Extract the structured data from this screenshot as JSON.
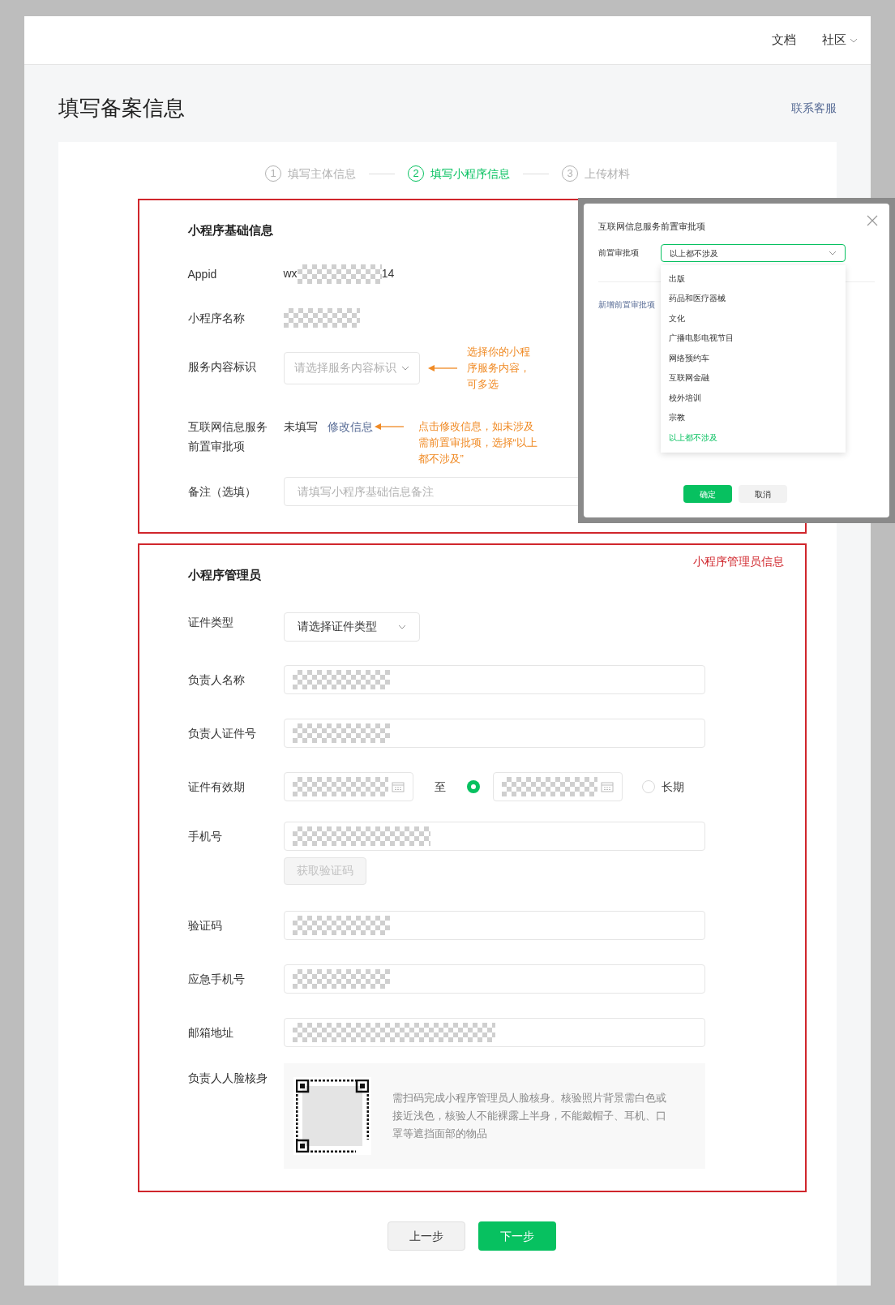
{
  "header": {
    "links": [
      {
        "label": "文档",
        "dropdown": false
      },
      {
        "label": "社区",
        "dropdown": true
      }
    ]
  },
  "page_title": "填写备案信息",
  "support_link": "联系客服",
  "steps": [
    {
      "number": "1",
      "label": "填写主体信息",
      "selected": false
    },
    {
      "number": "2",
      "label": "填写小程序信息",
      "selected": true
    },
    {
      "number": "3",
      "label": "上传材料",
      "selected": false
    }
  ],
  "basic_info": {
    "title": "小程序基础信息",
    "rows": [
      {
        "kind": "appid",
        "label": "Appid",
        "prefix": "wx",
        "suffix": "14"
      },
      {
        "kind": "redacted",
        "label": "小程序名称"
      },
      {
        "kind": "select",
        "label": "服务内容标识",
        "placeholder": "请选择服务内容标识",
        "annotation": "选择你的小程序服务内容，可多选"
      },
      {
        "kind": "status",
        "label": "互联网信息服务前置审批项",
        "value": "未填写",
        "link": "修改信息",
        "annotation": "点击修改信息，如未涉及需前置审批项，选择“以上都不涉及”"
      },
      {
        "kind": "input",
        "label": "备注（选填）",
        "placeholder": "请填写小程序基础信息备注"
      }
    ]
  },
  "admin": {
    "title": "小程序管理员",
    "tag": "小程序管理员信息",
    "rows": [
      {
        "kind": "select",
        "label": "证件类型",
        "placeholder": "请选择证件类型"
      },
      {
        "kind": "input",
        "label": "负责人名称"
      },
      {
        "kind": "input",
        "label": "负责人证件号"
      },
      {
        "kind": "date_range",
        "label": "证件有效期",
        "separator": "至",
        "end_options": [
          {
            "kind": "date",
            "checked": true
          },
          {
            "kind": "long_term",
            "label": "长期",
            "checked": false
          }
        ]
      },
      {
        "kind": "phone",
        "label": "手机号",
        "button": {
          "label": "获取验证码",
          "disabled": true
        }
      },
      {
        "kind": "input",
        "label": "验证码"
      },
      {
        "kind": "input",
        "label": "应急手机号"
      },
      {
        "kind": "input",
        "label": "邮箱地址"
      },
      {
        "kind": "face",
        "label": "负责人人脸核身",
        "description": "需扫码完成小程序管理员人脸核身。核验照片背景需白色或接近浅色，核验人不能裸露上半身，不能戴帽子、耳机、口罩等遮挡面部的物品"
      }
    ]
  },
  "buttons": [
    {
      "label": "上一步",
      "primary": false
    },
    {
      "label": "下一步",
      "primary": true
    }
  ],
  "dialog": {
    "title": "互联网信息服务前置审批项",
    "field_label": "前置审批项",
    "value": "以上都不涉及",
    "add_link": "新增前置审批项",
    "options": [
      {
        "label": "出版",
        "selected": false
      },
      {
        "label": "药品和医疗器械",
        "selected": false
      },
      {
        "label": "文化",
        "selected": false
      },
      {
        "label": "广播电影电视节目",
        "selected": false
      },
      {
        "label": "网络预约车",
        "selected": false
      },
      {
        "label": "互联网金融",
        "selected": false
      },
      {
        "label": "校外培训",
        "selected": false
      },
      {
        "label": "宗教",
        "selected": false
      },
      {
        "label": "以上都不涉及",
        "selected": true
      }
    ],
    "buttons": [
      {
        "label": "确定",
        "primary": true
      },
      {
        "label": "取消",
        "primary": false
      }
    ]
  }
}
